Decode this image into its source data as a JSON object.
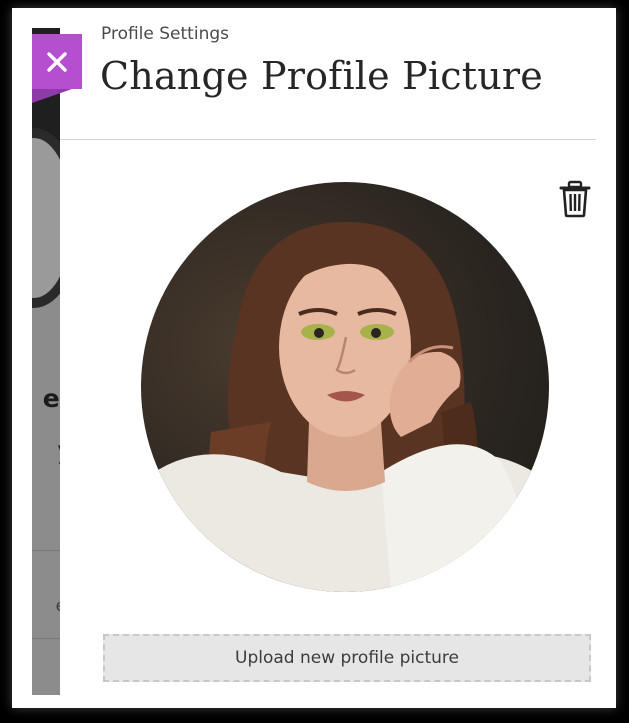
{
  "background_page": {
    "text_1": "er",
    "text_2": "y",
    "text_3": "er"
  },
  "panel": {
    "eyebrow": "Profile Settings",
    "title": "Change Profile Picture",
    "upload_label": "Upload new profile picture",
    "close_icon": "close-icon",
    "delete_icon": "trash-icon"
  },
  "colors": {
    "accent": "#b44fd0",
    "upload_bg": "#e6e6e6"
  }
}
